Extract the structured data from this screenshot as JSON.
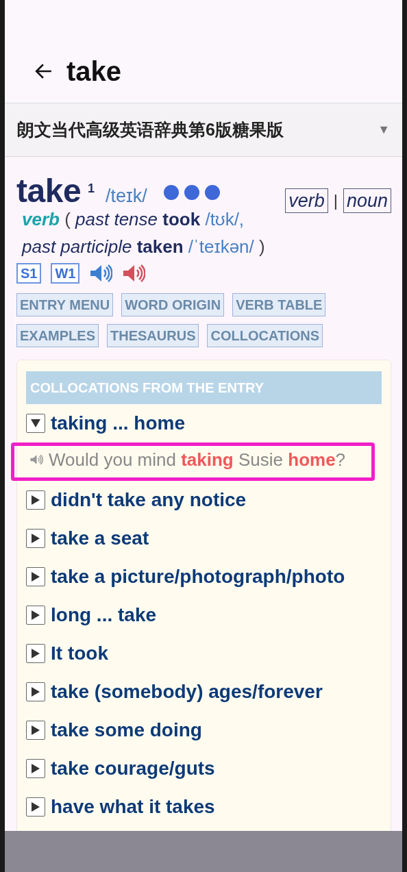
{
  "header": {
    "title": "take"
  },
  "dictionary_selector": {
    "value": "朗文当代高级英语辞典第6版糖果版",
    "caret": "▼"
  },
  "entry": {
    "headword": "take",
    "homograph": "1",
    "pronunciation": "/teɪk/",
    "pos_links": [
      {
        "label": "verb"
      },
      {
        "label": "noun"
      }
    ],
    "pos_separator": "|",
    "pos": "verb",
    "open": "(",
    "inflections": [
      {
        "label": "past tense",
        "form": "took",
        "pron": "/tʊk/,"
      },
      {
        "label": "past participle",
        "form": "taken",
        "pron": "/ˈteɪkən/"
      }
    ],
    "close": ")",
    "levels": [
      "S1",
      "W1"
    ],
    "sections": [
      "ENTRY MENU",
      "WORD ORIGIN",
      "VERB TABLE",
      "EXAMPLES",
      "THESAURUS",
      "COLLOCATIONS"
    ]
  },
  "collocations": {
    "title": "COLLOCATIONS FROM THE ENTRY",
    "items": [
      {
        "text": "taking ... home",
        "expanded": true,
        "examples": [
          {
            "text": "Would you mind **taking** Susie **home**?",
            "highlighted": true
          }
        ]
      },
      {
        "text": "didn't take any notice",
        "expanded": false
      },
      {
        "text": "take a seat",
        "expanded": false
      },
      {
        "text": "take a picture/photograph/photo",
        "expanded": false
      },
      {
        "text": "long ... take",
        "expanded": false
      },
      {
        "text": "It took",
        "expanded": false
      },
      {
        "text": "take (somebody) ages/forever",
        "expanded": false
      },
      {
        "text": "take some doing",
        "expanded": false
      },
      {
        "text": "take courage/guts",
        "expanded": false
      },
      {
        "text": "have what it takes",
        "expanded": false
      }
    ]
  }
}
